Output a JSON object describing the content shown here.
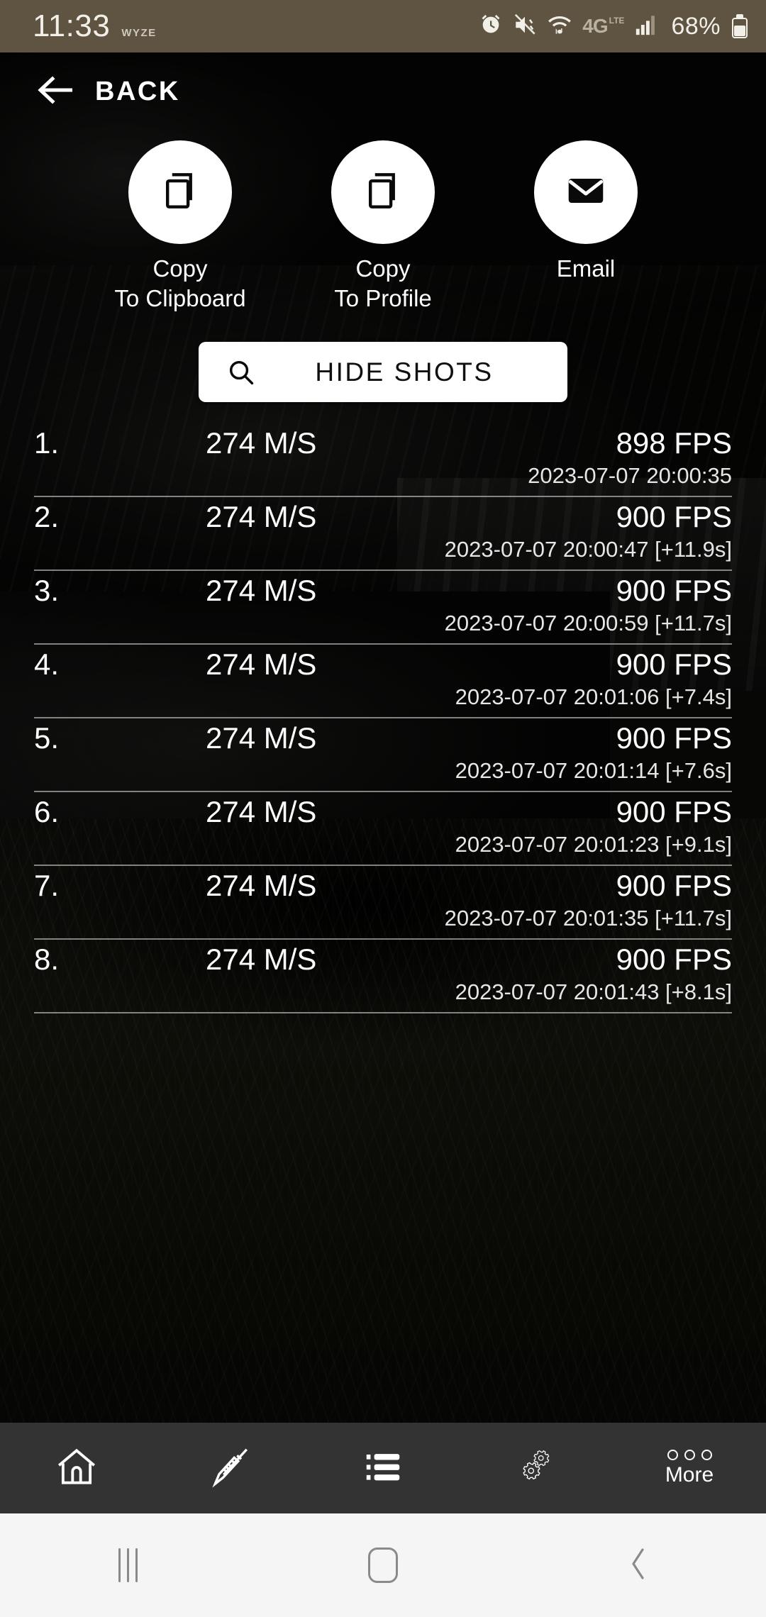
{
  "status_bar": {
    "clock": "11:33",
    "carrier": "WYZE",
    "battery_percent": "68%",
    "icons": [
      "alarm-icon",
      "mute-vibrate-icon",
      "wifi-icon",
      "4g-lte-icon",
      "cell-signal-icon",
      "battery-icon"
    ],
    "background_color": "#5e5441"
  },
  "header": {
    "back_label": "BACK",
    "back_icon": "arrow-left-icon"
  },
  "actions": [
    {
      "icon": "copy-icon",
      "label": "Copy\nTo Clipboard"
    },
    {
      "icon": "copy-icon",
      "label": "Copy\nTo Profile"
    },
    {
      "icon": "email-icon",
      "label": "Email"
    }
  ],
  "hide_shots": {
    "label": "HIDE SHOTS",
    "icon": "search-icon"
  },
  "shots": {
    "columns": [
      "index",
      "speed",
      "fps",
      "timestamp"
    ],
    "rows": [
      {
        "index": "1.",
        "speed": "274 M/S",
        "fps": "898 FPS",
        "timestamp": "2023-07-07 20:00:35"
      },
      {
        "index": "2.",
        "speed": "274 M/S",
        "fps": "900 FPS",
        "timestamp": "2023-07-07 20:00:47 [+11.9s]"
      },
      {
        "index": "3.",
        "speed": "274 M/S",
        "fps": "900 FPS",
        "timestamp": "2023-07-07 20:00:59 [+11.7s]"
      },
      {
        "index": "4.",
        "speed": "274 M/S",
        "fps": "900 FPS",
        "timestamp": "2023-07-07 20:01:06 [+7.4s]"
      },
      {
        "index": "5.",
        "speed": "274 M/S",
        "fps": "900 FPS",
        "timestamp": "2023-07-07 20:01:14 [+7.6s]"
      },
      {
        "index": "6.",
        "speed": "274 M/S",
        "fps": "900 FPS",
        "timestamp": "2023-07-07 20:01:23 [+9.1s]"
      },
      {
        "index": "7.",
        "speed": "274 M/S",
        "fps": "900 FPS",
        "timestamp": "2023-07-07 20:01:35 [+11.7s]"
      },
      {
        "index": "8.",
        "speed": "274 M/S",
        "fps": "900 FPS",
        "timestamp": "2023-07-07 20:01:43 [+8.1s]"
      }
    ]
  },
  "app_nav": {
    "background_color": "#333333",
    "items": [
      {
        "icon": "home-icon",
        "label": ""
      },
      {
        "icon": "rifle-icon",
        "label": ""
      },
      {
        "icon": "list-icon",
        "label": ""
      },
      {
        "icon": "gears-icon",
        "label": ""
      },
      {
        "icon": "more-dots-icon",
        "label": "More"
      }
    ]
  },
  "system_nav": {
    "background_color": "#f5f5f5",
    "items": [
      "recents-icon",
      "home-icon",
      "back-icon"
    ]
  }
}
